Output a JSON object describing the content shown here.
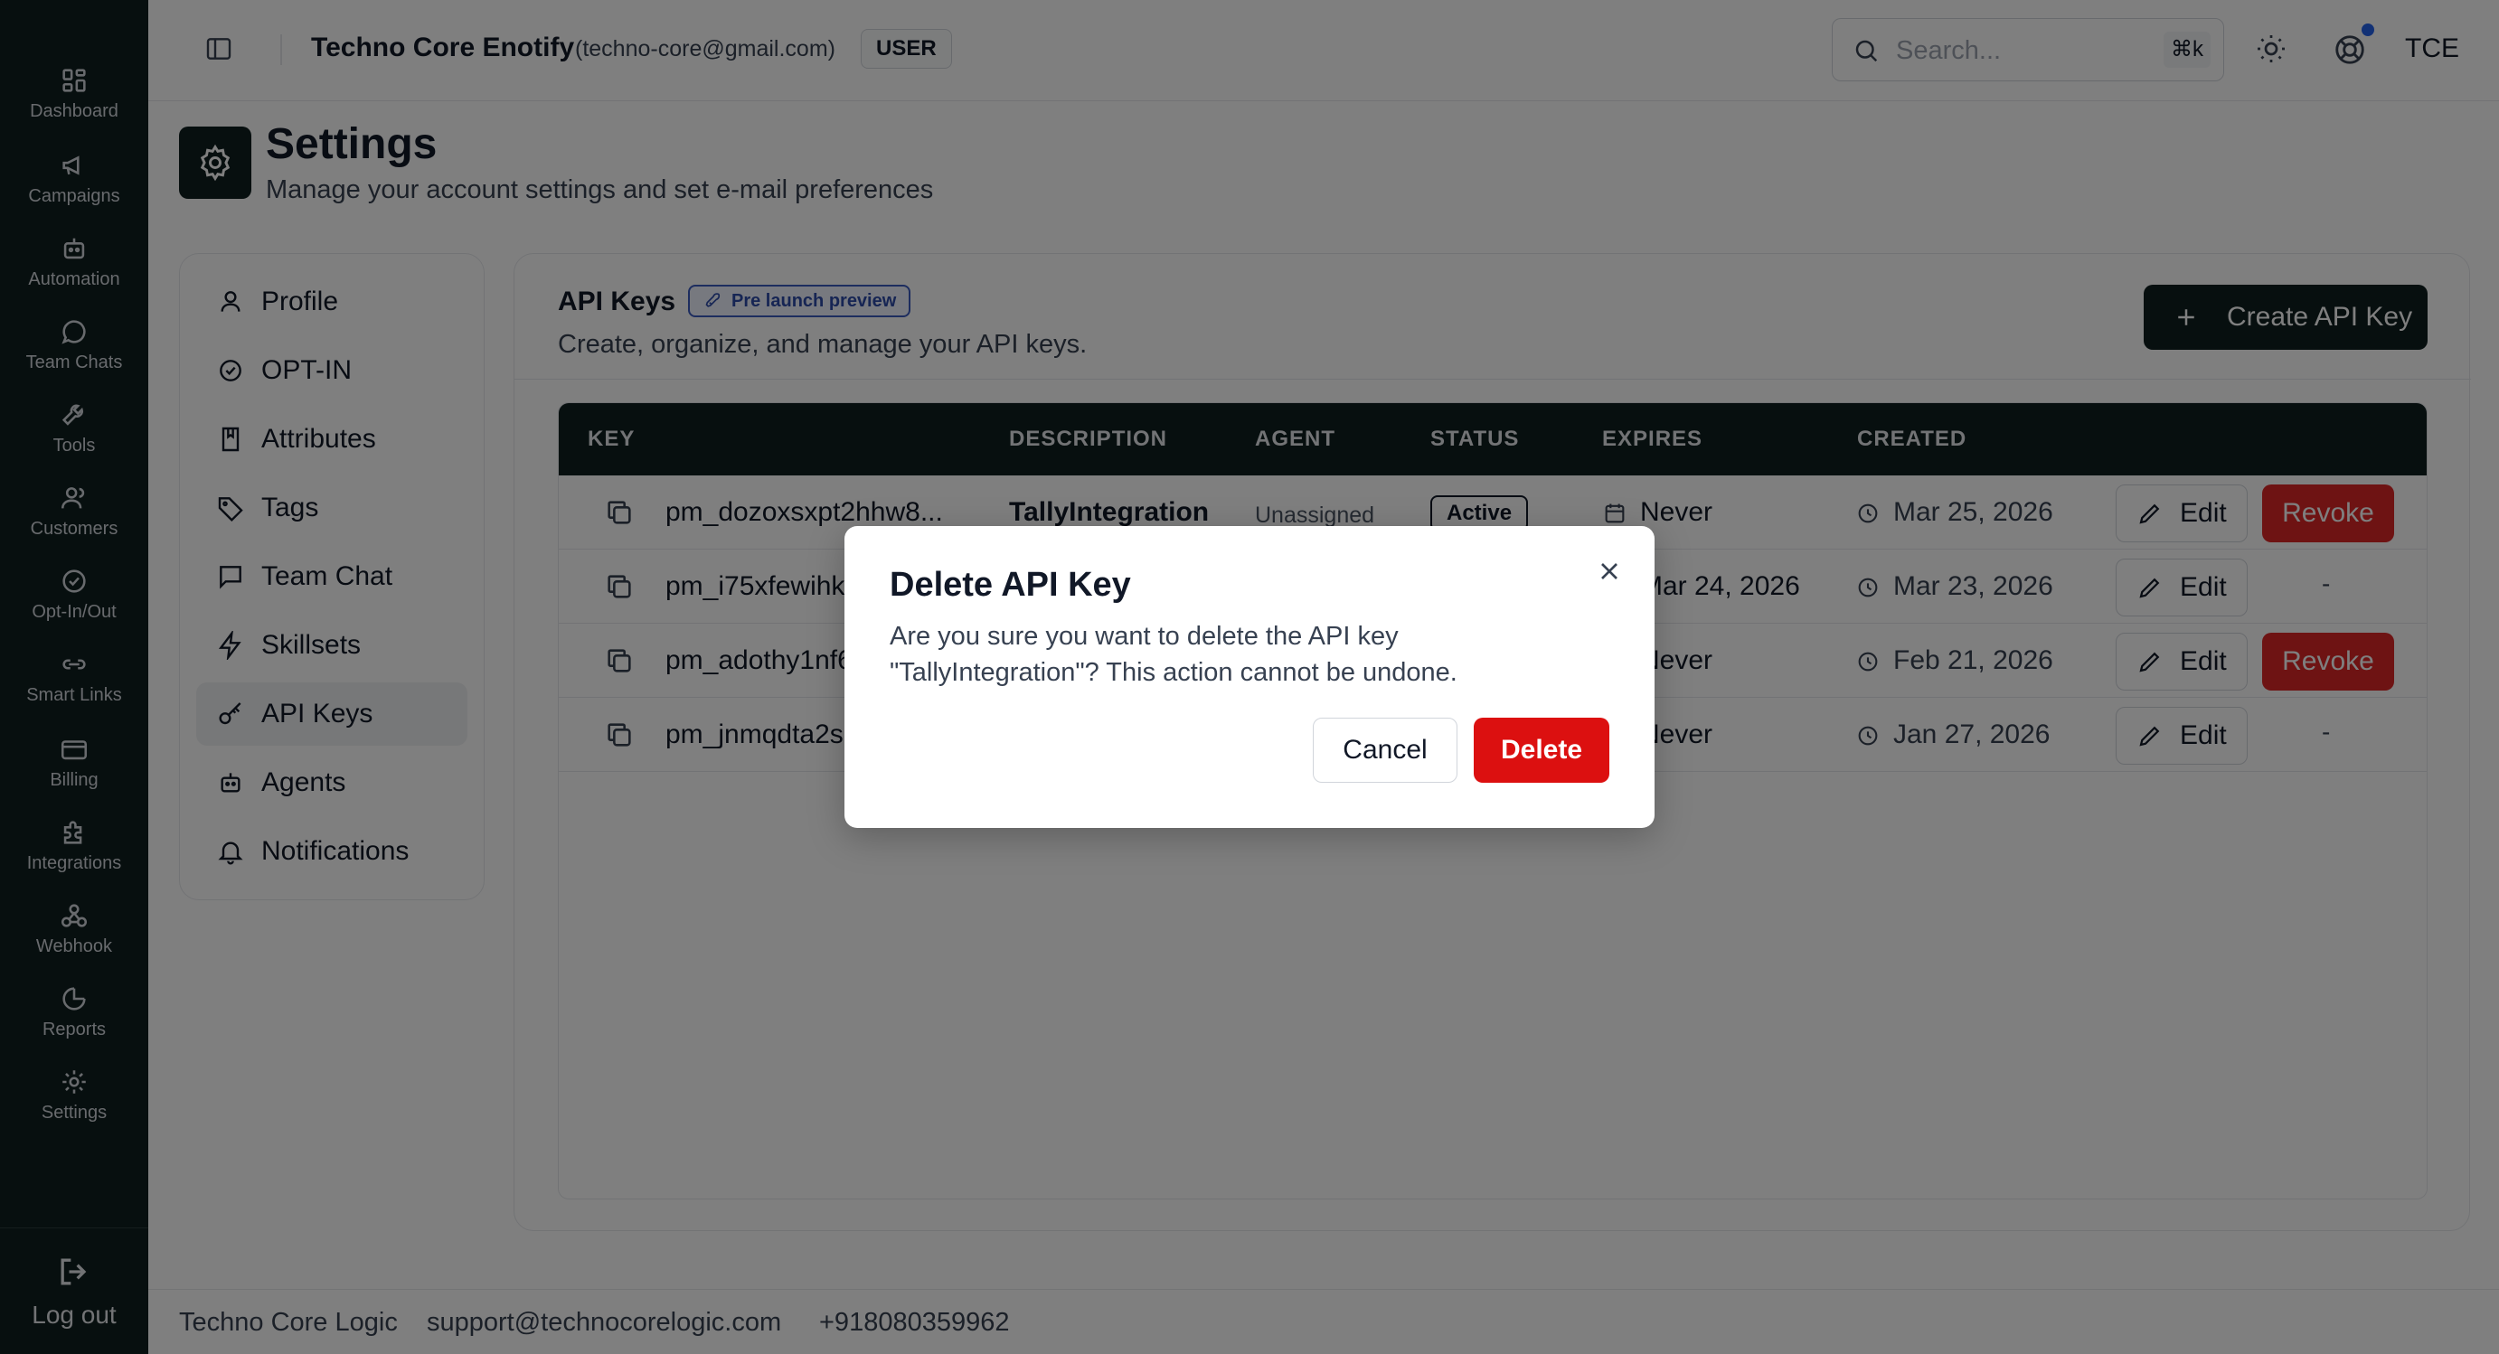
{
  "nav": {
    "items": [
      {
        "label": "Dashboard",
        "icon": "dashboard-icon"
      },
      {
        "label": "Campaigns",
        "icon": "megaphone-icon"
      },
      {
        "label": "Automation",
        "icon": "bot-icon"
      },
      {
        "label": "Team Chats",
        "icon": "chat-bubble-icon"
      },
      {
        "label": "Tools",
        "icon": "wrench-icon"
      },
      {
        "label": "Customers",
        "icon": "users-icon"
      },
      {
        "label": "Opt-In/Out",
        "icon": "check-circle-icon"
      },
      {
        "label": "Smart Links",
        "icon": "link-icon"
      },
      {
        "label": "Billing",
        "icon": "credit-card-icon"
      },
      {
        "label": "Integrations",
        "icon": "puzzle-icon"
      },
      {
        "label": "Webhook",
        "icon": "webhook-icon"
      },
      {
        "label": "Reports",
        "icon": "pie-chart-icon"
      },
      {
        "label": "Settings",
        "icon": "gear-icon"
      }
    ],
    "logout_label": "Log out"
  },
  "header": {
    "org_name": "Techno Core Enotify",
    "org_email": "(techno-core@gmail.com)",
    "role": "USER",
    "search_placeholder": "Search...",
    "search_shortcut": "⌘k",
    "user_initials": "TCE"
  },
  "page": {
    "title": "Settings",
    "subtitle": "Manage your account settings and set e-mail preferences"
  },
  "settings_menu": {
    "items": [
      {
        "label": "Profile",
        "icon": "user-icon"
      },
      {
        "label": "OPT-IN",
        "icon": "check-circle-icon"
      },
      {
        "label": "Attributes",
        "icon": "book-icon"
      },
      {
        "label": "Tags",
        "icon": "tag-icon"
      },
      {
        "label": "Team Chat",
        "icon": "message-square-icon"
      },
      {
        "label": "Skillsets",
        "icon": "zap-icon"
      },
      {
        "label": "API Keys",
        "icon": "key-icon",
        "active": true
      },
      {
        "label": "Agents",
        "icon": "bot-icon"
      },
      {
        "label": "Notifications",
        "icon": "bell-icon"
      }
    ]
  },
  "api_keys": {
    "title": "API Keys",
    "preview_badge": "Pre launch preview",
    "subtitle": "Create, organize, and manage your API keys.",
    "create_label": "Create API Key",
    "columns": [
      "KEY",
      "DESCRIPTION",
      "AGENT",
      "STATUS",
      "EXPIRES",
      "CREATED"
    ],
    "rows": [
      {
        "key": "pm_dozoxsxpt2hhw8...",
        "description": "TallyIntegration",
        "agent": "Unassigned",
        "status": "Active",
        "expires": "Never",
        "created": "Mar 25, 2026",
        "edit": "Edit",
        "revoke": "Revoke"
      },
      {
        "key": "pm_i75xfewihk",
        "description": "",
        "agent": "",
        "status": "",
        "expires": "Mar 24, 2026",
        "created": "Mar 23, 2026",
        "edit": "Edit",
        "revoke": "-"
      },
      {
        "key": "pm_adothy1nf6",
        "description": "",
        "agent": "",
        "status": "",
        "expires": "Never",
        "created": "Feb 21, 2026",
        "edit": "Edit",
        "revoke": "Revoke"
      },
      {
        "key": "pm_jnmqdta2s",
        "description": "",
        "agent": "",
        "status": "",
        "expires": "Never",
        "created": "Jan 27, 2026",
        "edit": "Edit",
        "revoke": "-"
      }
    ]
  },
  "footer": {
    "company": "Techno Core Logic",
    "email": "support@technocorelogic.com",
    "phone": "+918080359962"
  },
  "dialog": {
    "title": "Delete API Key",
    "message": "Are you sure you want to delete the API key \"TallyIntegration\"? This action cannot be undone.",
    "cancel_label": "Cancel",
    "delete_label": "Delete"
  },
  "colors": {
    "nav_bg": "#0f1f1f",
    "danger": "#dc2626",
    "accent": "#2563eb"
  }
}
